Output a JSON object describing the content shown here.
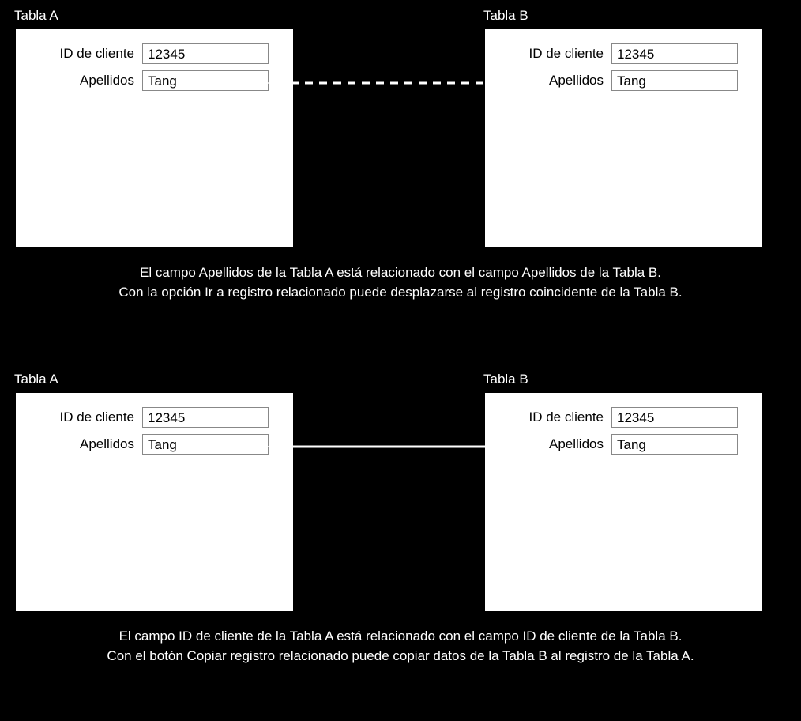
{
  "panels": {
    "top_left": {
      "title": "Tabla A",
      "fields": {
        "id_label": "ID de cliente",
        "id_value": "12345",
        "last_label": "Apellidos",
        "last_value": "Tang"
      }
    },
    "top_right": {
      "title": "Tabla B",
      "fields": {
        "id_label": "ID de cliente",
        "id_value": "12345",
        "last_label": "Apellidos",
        "last_value": "Tang"
      }
    },
    "bottom_left": {
      "title": "Tabla A",
      "fields": {
        "id_label": "ID de cliente",
        "id_value": "12345",
        "last_label": "Apellidos",
        "last_value": "Tang"
      }
    },
    "bottom_right": {
      "title": "Tabla B",
      "fields": {
        "id_label": "ID de cliente",
        "id_value": "12345",
        "last_label": "Apellidos",
        "last_value": "Tang"
      }
    }
  },
  "captions": {
    "top_relation": "El campo Apellidos de la Tabla A está relacionado con el campo Apellidos de la Tabla B.",
    "top_button": "Con la opción Ir a registro relacionado puede desplazarse al registro coincidente de la Tabla B.",
    "bottom_relation": "El campo ID de cliente de la Tabla A está relacionado con el campo ID de cliente de la Tabla B.",
    "bottom_button": "Con el botón Copiar registro relacionado puede copiar datos de la Tabla B al registro de la Tabla A."
  },
  "colors": {
    "bg": "#000000",
    "panel_bg": "#ffffff",
    "panel_border": "#000000",
    "text_white": "#ffffff",
    "text_black": "#000000",
    "field_border": "#888888"
  }
}
